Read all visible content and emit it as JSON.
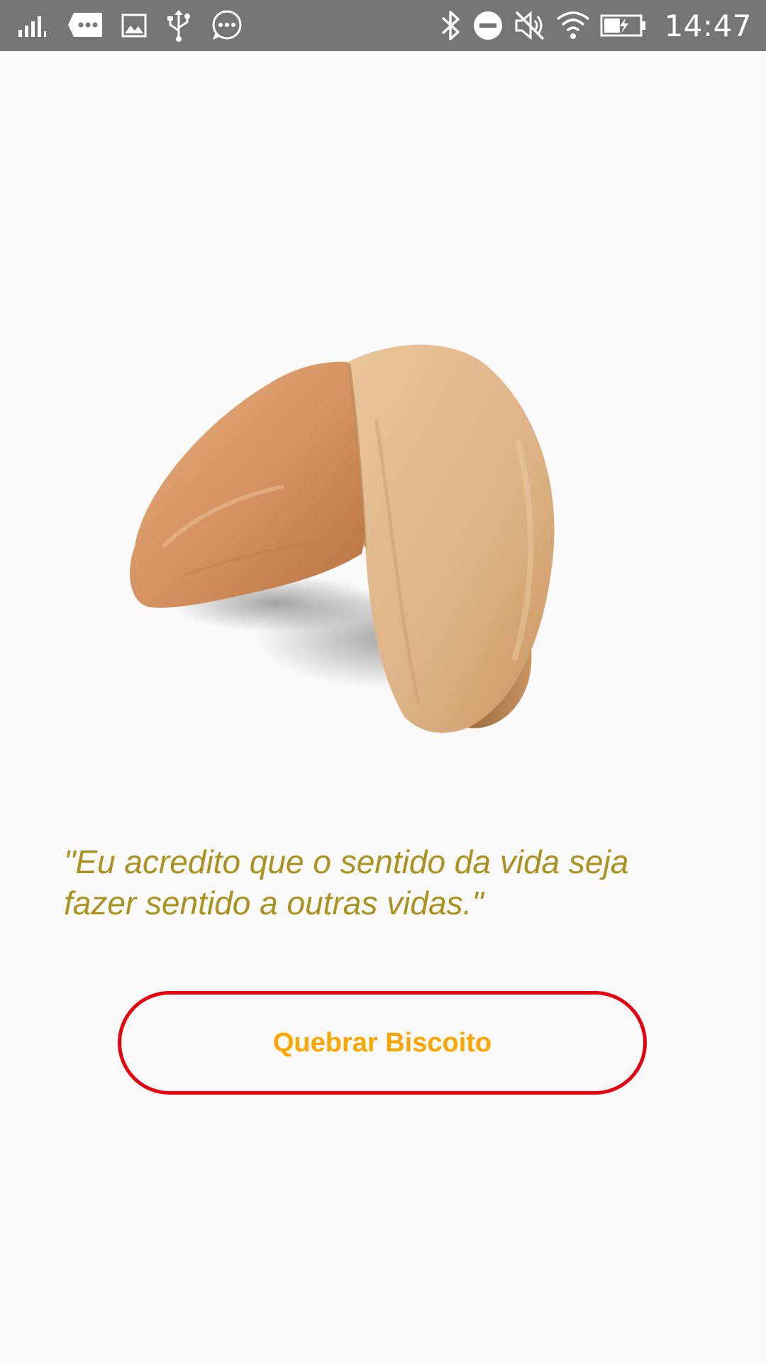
{
  "status_bar": {
    "time": "14:47",
    "icons_left": [
      "signal-icon",
      "message-icon",
      "image-icon",
      "usb-icon",
      "chat-icon"
    ],
    "icons_right": [
      "bluetooth-icon",
      "do-not-disturb-icon",
      "mute-icon",
      "wifi-icon",
      "battery-icon"
    ],
    "background_color": "#757575"
  },
  "main": {
    "image": "fortune-cookie",
    "quote": "\"Eu acredito que o sentido da vida seja fazer sentido a outras vidas.\"",
    "quote_color": "#a9921e",
    "button_label": "Quebrar Biscoito",
    "button_border_color": "#e8000e",
    "button_text_color": "#ffa500"
  }
}
